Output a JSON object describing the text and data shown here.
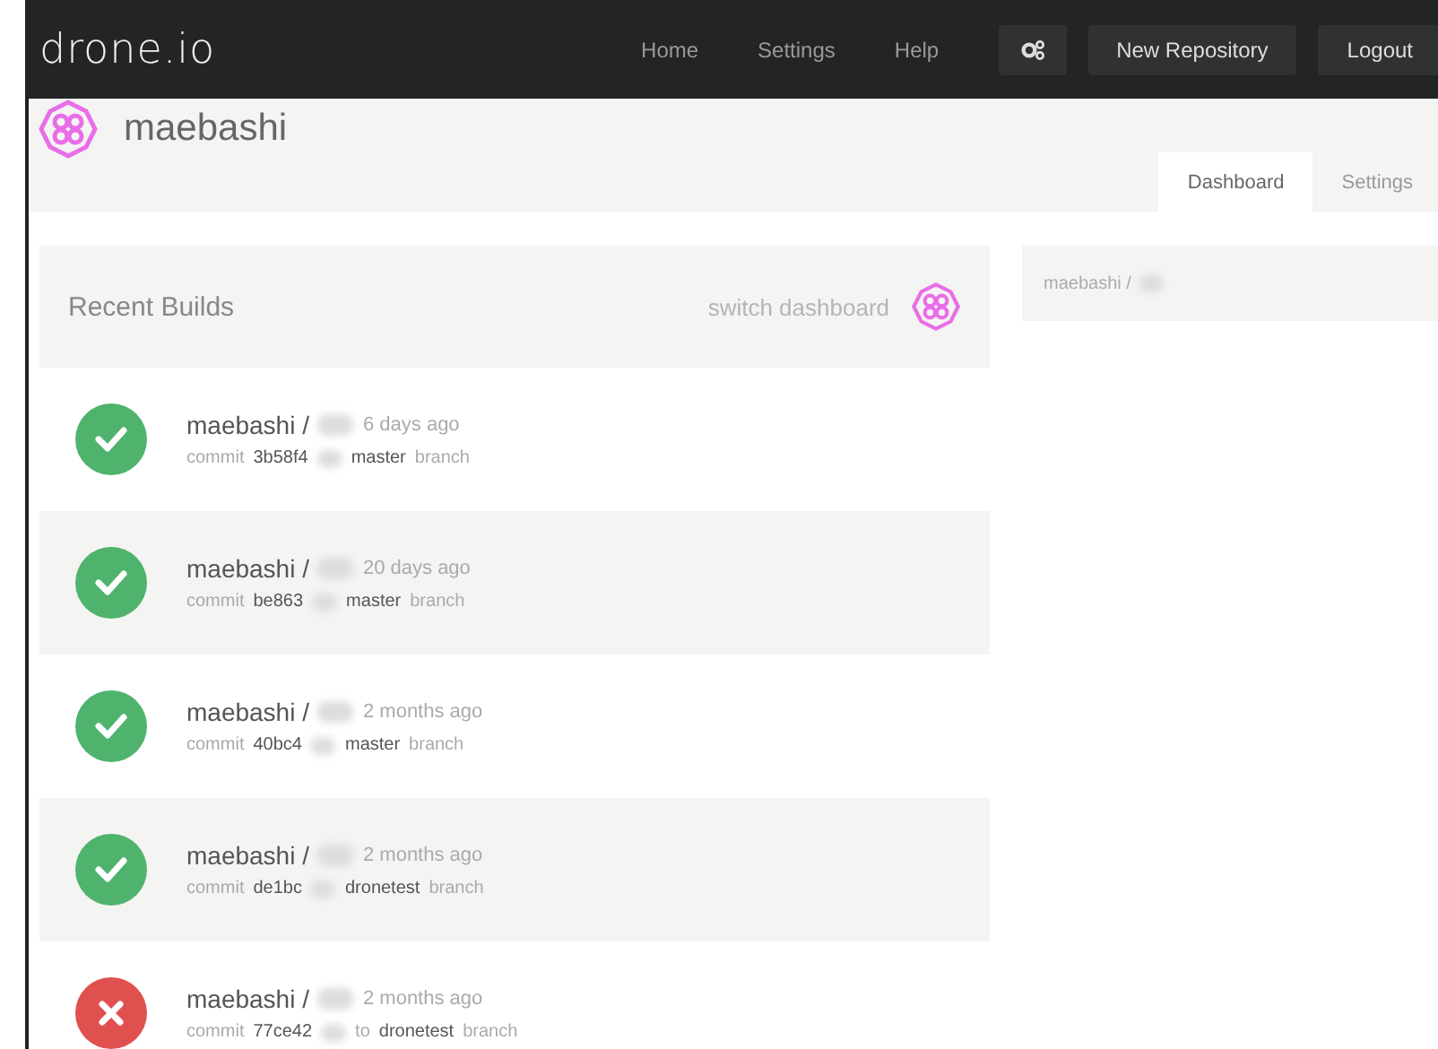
{
  "navbar": {
    "logo": "drone.io",
    "links": [
      "Home",
      "Settings",
      "Help"
    ],
    "buttons": [
      "New Repository",
      "Logout"
    ]
  },
  "header": {
    "username": "maebashi",
    "tabs": [
      {
        "label": "Dashboard",
        "selected": true
      },
      {
        "label": "Settings",
        "selected": false
      }
    ]
  },
  "recent_builds": {
    "title": "Recent Builds",
    "switch_label": "switch dashboard",
    "rows": [
      {
        "kind": "success",
        "owner": "maebashi /",
        "when": "6 days ago",
        "commit_label": "commit",
        "hash": "3b58f4",
        "branch": "master",
        "branch_label": "branch"
      },
      {
        "kind": "success",
        "owner": "maebashi /",
        "when": "20 days ago",
        "commit_label": "commit",
        "hash": "be863",
        "branch": "master",
        "branch_label": "branch"
      },
      {
        "kind": "success",
        "owner": "maebashi /",
        "when": "2 months ago",
        "commit_label": "commit",
        "hash": "40bc4",
        "branch": "master",
        "branch_label": "branch"
      },
      {
        "kind": "success",
        "owner": "maebashi /",
        "when": "2 months ago",
        "commit_label": "commit",
        "hash": "de1bc",
        "branch": "dronetest",
        "branch_label": "branch"
      },
      {
        "kind": "failure",
        "owner": "maebashi /",
        "when": "2 months ago",
        "commit_label": "commit",
        "hash": "77ce42",
        "to": "to",
        "branch": "dronetest",
        "branch_label": "branch"
      }
    ]
  },
  "repos": [
    {
      "owner": "maebashi /"
    }
  ]
}
